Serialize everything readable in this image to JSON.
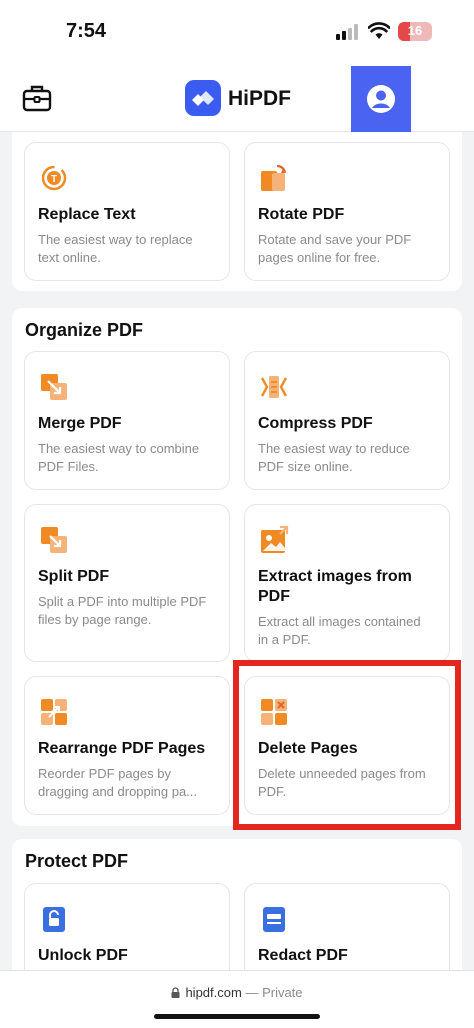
{
  "status_bar": {
    "time": "7:54",
    "battery_level": "16"
  },
  "header": {
    "brand_name": "HiPDF",
    "colors": {
      "brand": "#3b5cf0",
      "account_bg": "#4a63f0"
    }
  },
  "edit_section": {
    "cards": [
      {
        "title": "Replace Text",
        "desc1": "The easiest way to replace",
        "desc2": "text online.",
        "icon": "replace-text-icon"
      },
      {
        "title": "Rotate PDF",
        "desc1": "Rotate and save your PDF",
        "desc2": "pages online for free.",
        "icon": "rotate-pdf-icon"
      }
    ]
  },
  "organize_section": {
    "title": "Organize PDF",
    "cards": [
      {
        "title": "Merge PDF",
        "desc1": "The easiest way to combine",
        "desc2": "PDF Files.",
        "icon": "merge-pdf-icon"
      },
      {
        "title": "Compress PDF",
        "desc1": "The easiest way to reduce",
        "desc2": "PDF size online.",
        "icon": "compress-pdf-icon"
      },
      {
        "title": "Split PDF",
        "desc1": "Split a PDF into multiple PDF",
        "desc2": "files by page range.",
        "icon": "split-pdf-icon"
      },
      {
        "title1": "Extract images from",
        "title2": "PDF",
        "desc1": "Extract all images contained",
        "desc2": "in a PDF.",
        "icon": "extract-images-icon"
      },
      {
        "title": "Rearrange PDF Pages",
        "desc1": "Reorder PDF pages by",
        "desc2": "dragging and dropping pa...",
        "icon": "rearrange-pages-icon"
      },
      {
        "title": "Delete Pages",
        "desc1": "Delete unneeded pages from",
        "desc2": "PDF.",
        "icon": "delete-pages-icon"
      }
    ]
  },
  "protect_section": {
    "title": "Protect PDF",
    "cards": [
      {
        "title": "Unlock PDF",
        "icon": "unlock-pdf-icon"
      },
      {
        "title": "Redact PDF",
        "icon": "redact-pdf-icon"
      }
    ]
  },
  "browser": {
    "url": "hipdf.com",
    "mode": "— Private"
  },
  "colors": {
    "accent_orange": "#f08a24",
    "highlight_red": "#e3261f",
    "tool_blue": "#3a6fe0"
  }
}
